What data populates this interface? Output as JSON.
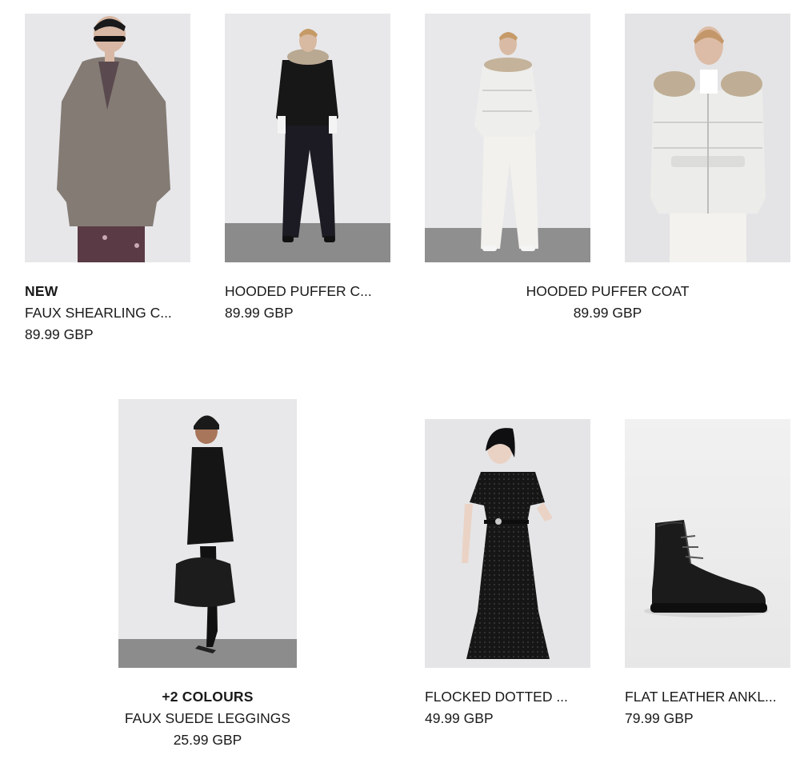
{
  "products": [
    {
      "badge": "NEW",
      "name": "FAUX SHEARLING C...",
      "price": "89.99 GBP",
      "image_icon": "faux-shearling-coat-photo"
    },
    {
      "badge": "",
      "name": "HOODED PUFFER C...",
      "price": "89.99 GBP",
      "image_icon": "black-hooded-puffer-photo"
    },
    {
      "badge": "",
      "name": "HOODED PUFFER COAT",
      "price": "89.99 GBP",
      "image_icon": "white-hooded-puffer-photo",
      "image_icon_2": "white-puffer-closeup-photo"
    },
    {
      "badge": "+2 COLOURS",
      "name": "FAUX SUEDE LEGGINGS",
      "price": "25.99 GBP",
      "image_icon": "black-outfit-leggings-photo"
    },
    {
      "badge": "",
      "name": "FLOCKED DOTTED ...",
      "price": "49.99 GBP",
      "image_icon": "flocked-dotted-dress-photo"
    },
    {
      "badge": "",
      "name": "FLAT LEATHER ANKL...",
      "price": "79.99 GBP",
      "image_icon": "leather-ankle-boot-photo"
    }
  ]
}
